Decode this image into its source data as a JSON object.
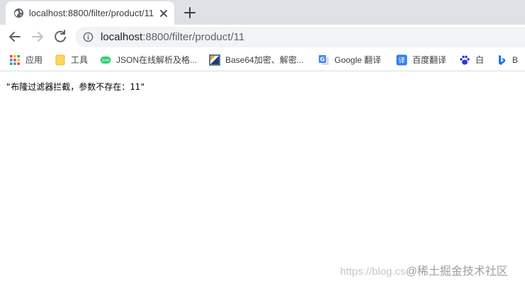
{
  "tab": {
    "title": "localhost:8800/filter/product/11",
    "favicon": "globe-icon"
  },
  "toolbar": {
    "back_icon": "arrow-left-icon",
    "forward_icon": "arrow-right-icon",
    "reload_icon": "reload-icon",
    "info_icon": "info-icon",
    "url_host": "localhost",
    "url_path": ":8800/filter/product/11"
  },
  "bookmarks": [
    {
      "label": "应用",
      "icon": "apps-grid-icon"
    },
    {
      "label": "工具",
      "icon": "folder-icon"
    },
    {
      "label": "JSON在线解析及格...",
      "icon": "json-icon"
    },
    {
      "label": "Base64加密、解密...",
      "icon": "base64-icon"
    },
    {
      "label": "Google 翻译",
      "icon": "google-translate-icon"
    },
    {
      "label": "百度翻译",
      "icon": "baidu-translate-icon"
    },
    {
      "label": "白",
      "icon": "baidu-paw-icon"
    },
    {
      "label": "B",
      "icon": "bing-icon"
    }
  ],
  "page": {
    "body_text": "\"布隆过滤器拦截，参数不存在：11\""
  },
  "watermark": {
    "text": "https://blog.cs",
    "brand": "@稀土掘金技术社区"
  },
  "colors": {
    "tabstrip": "#dee1e6",
    "omnibox": "#f1f3f4",
    "text": "#3c4043"
  }
}
